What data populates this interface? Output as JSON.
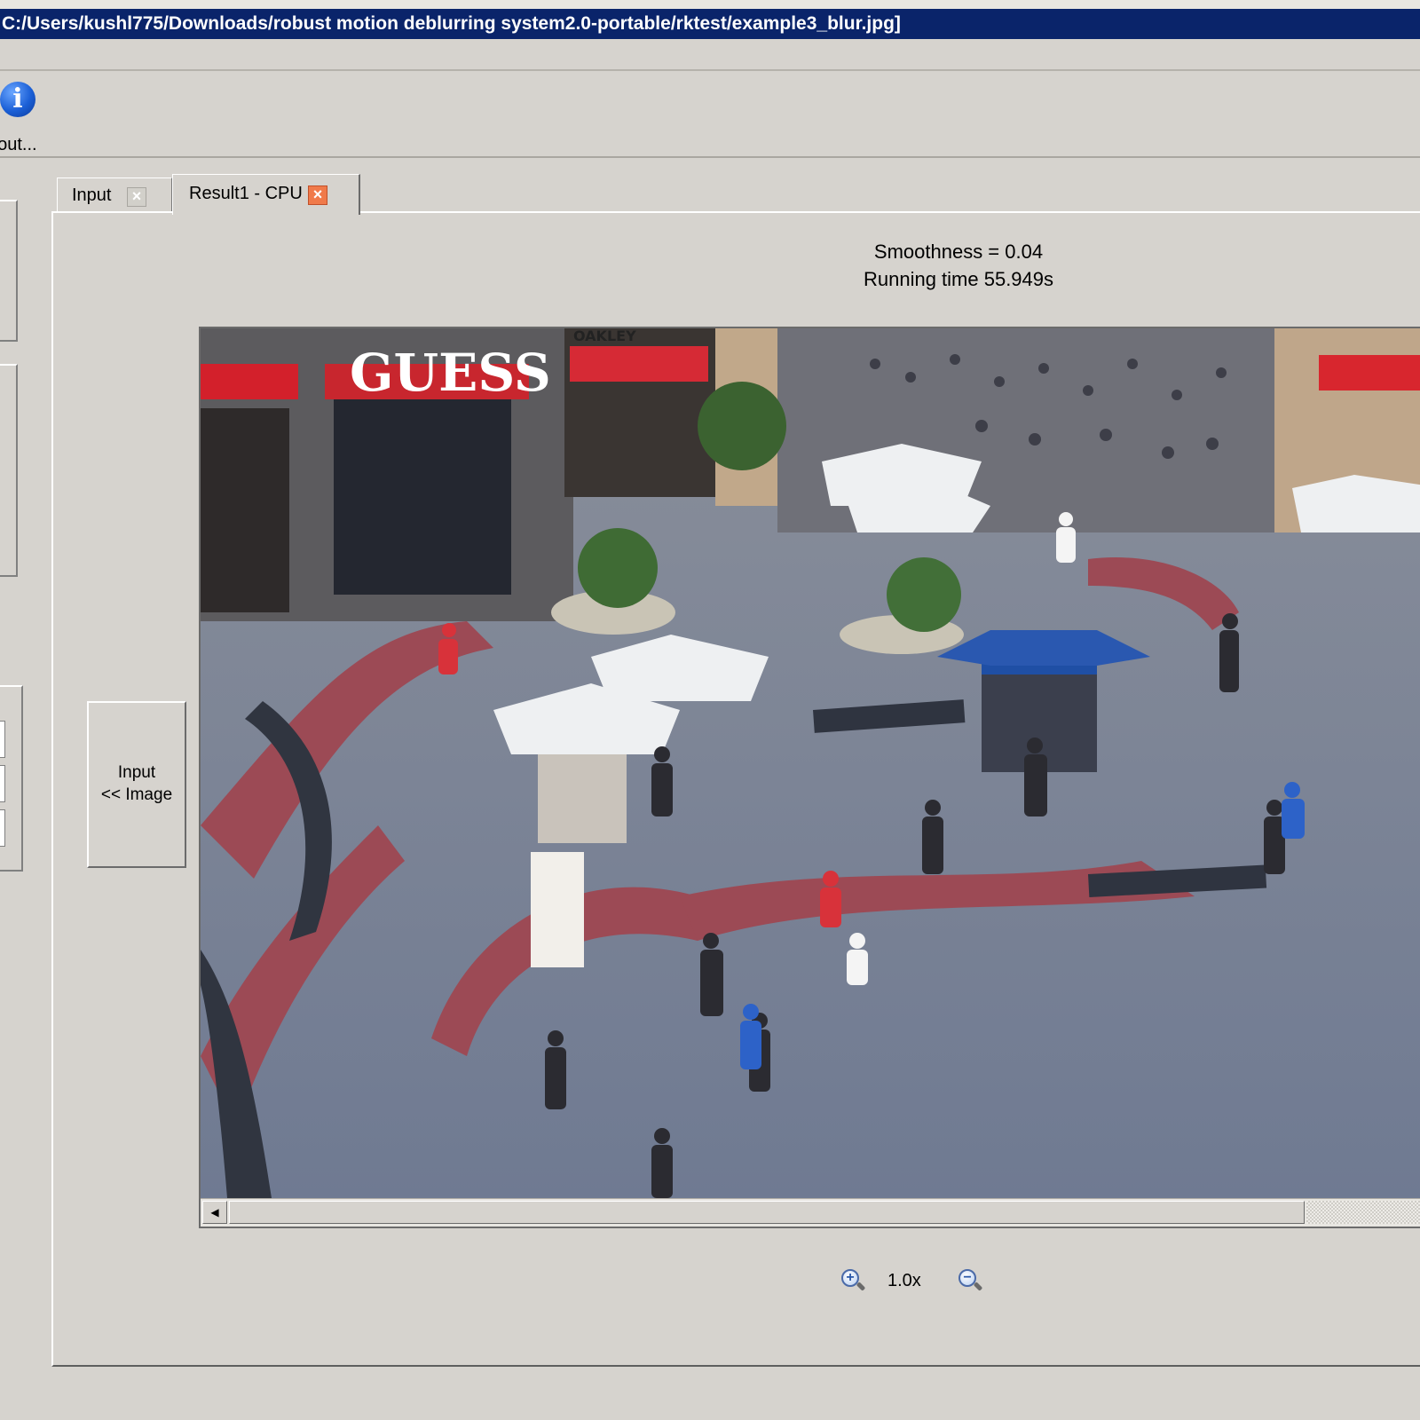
{
  "window": {
    "title": "C:/Users/kushl775/Downloads/robust motion deblurring system2.0-portable/rktest/example3_blur.jpg]"
  },
  "toolbar": {
    "about_label": "bout...",
    "about_icon": "info-icon"
  },
  "tabs": [
    {
      "label": "Input",
      "close_icon": "close-icon"
    },
    {
      "label": "Result1 - CPU",
      "close_icon": "close-icon",
      "active": true
    }
  ],
  "result": {
    "smoothness": "Smoothness = 0.04",
    "running_time": "Running time 55.949s"
  },
  "input_button": {
    "label": "Input\n<< Image"
  },
  "image": {
    "description_sign": "GUESS",
    "awning_text": "OAKLEY"
  },
  "scrollbar": {
    "left_arrow": "◀"
  },
  "zoom": {
    "level": "1.0x",
    "zoom_in_icon": "zoom-in-icon",
    "zoom_out_icon": "zoom-out-icon"
  },
  "colors": {
    "titlebar": "#0a246a",
    "active_close": "#f07a4a",
    "window_bg": "#d6d3ce"
  }
}
